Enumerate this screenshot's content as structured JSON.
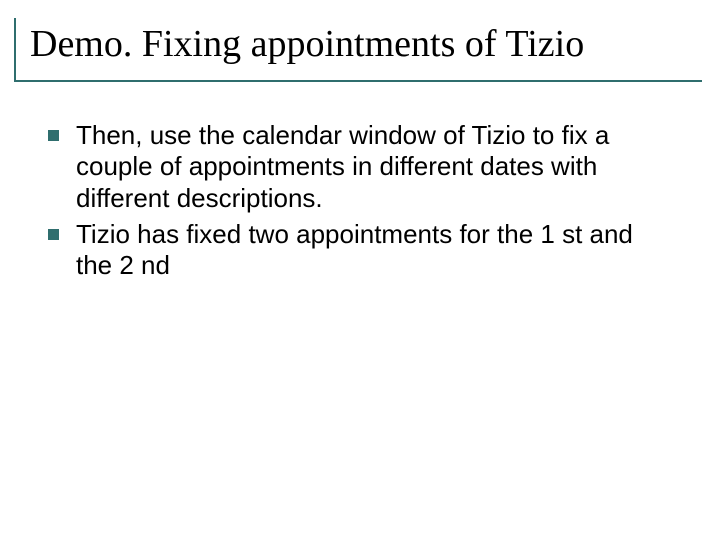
{
  "slide": {
    "title": "Demo. Fixing appointments of Tizio",
    "bullets": [
      "Then, use the calendar window of Tizio to fix a couple of appointments in different dates with different descriptions.",
      "Tizio has fixed two appointments for the 1 st and the 2 nd"
    ]
  },
  "colors": {
    "accent": "#2f6e6e"
  }
}
